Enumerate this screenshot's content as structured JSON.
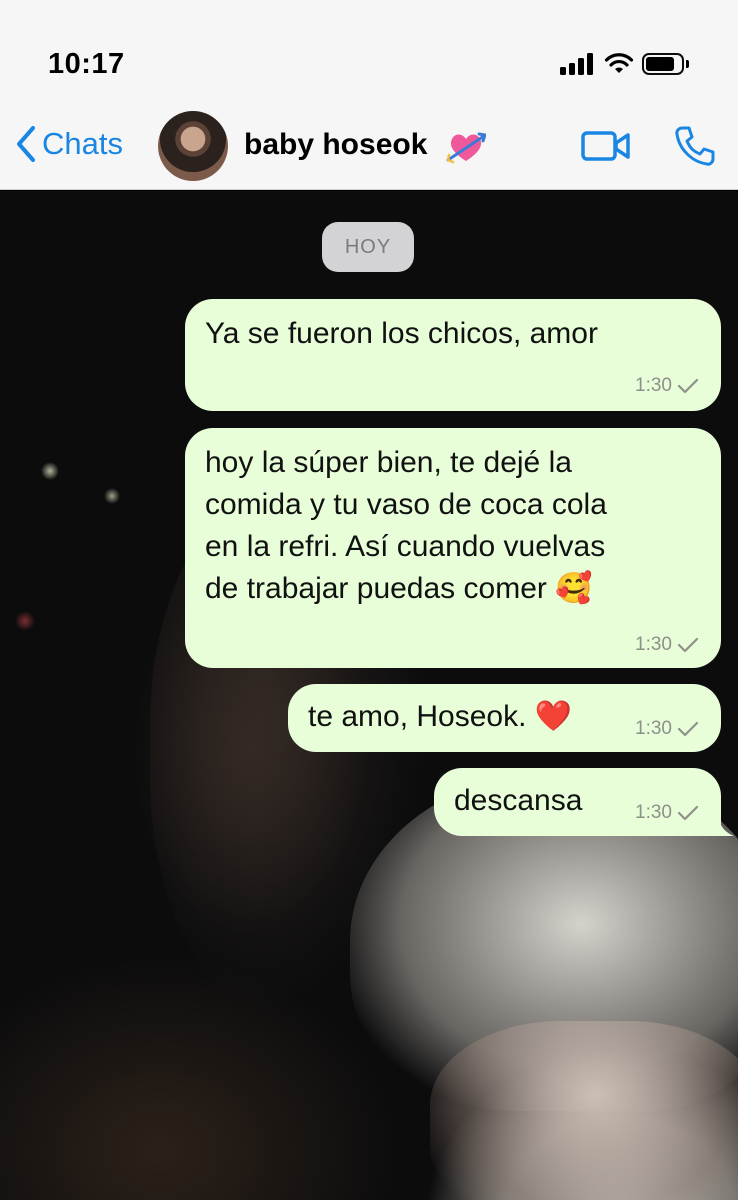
{
  "status_bar": {
    "time": "10:17"
  },
  "header": {
    "back_label": "Chats",
    "contact_name": "baby hoseok",
    "contact_emoji": "heart-with-arrow",
    "video_icon": "video-camera-icon",
    "call_icon": "phone-icon"
  },
  "chat": {
    "date_label": "HOY",
    "messages": [
      {
        "lines": [
          "Ya se fueron los chicos, amor"
        ],
        "time": "1:30",
        "status": "sent"
      },
      {
        "lines": [
          "hoy la súper bien, te dejé la",
          "comida y tu vaso de coca cola",
          "en la refri. Así cuando vuelvas",
          "de trabajar puedas comer 🥰"
        ],
        "time": "1:30",
        "status": "sent"
      },
      {
        "lines": [
          "te amo, Hoseok. ❤️"
        ],
        "time": "1:30",
        "status": "sent"
      },
      {
        "lines": [
          "descansa"
        ],
        "time": "1:30",
        "status": "sent"
      }
    ]
  },
  "colors": {
    "accent": "#1a86e3",
    "outgoing_bubble": "#e7fed8",
    "header_bg": "#f6f6f6",
    "date_pill": "#d3d3d6"
  }
}
